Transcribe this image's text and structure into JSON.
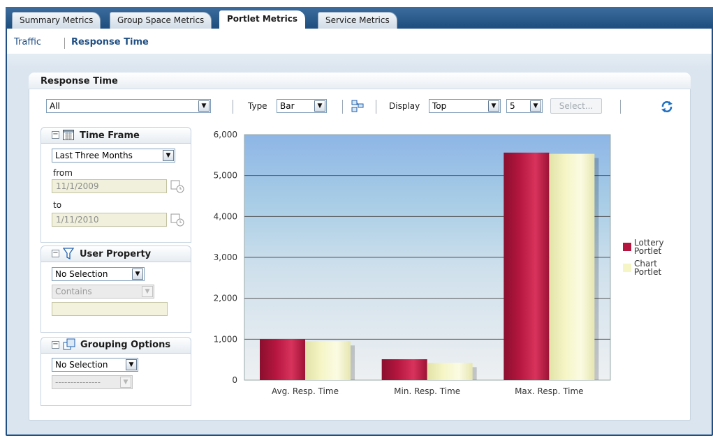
{
  "tabs": [
    {
      "label": "Summary Metrics",
      "active": false
    },
    {
      "label": "Group Space Metrics",
      "active": false
    },
    {
      "label": "Portlet Metrics",
      "active": true
    },
    {
      "label": "Service Metrics",
      "active": false
    }
  ],
  "subnav": {
    "traffic": "Traffic",
    "response_time": "Response Time"
  },
  "section": {
    "title": "Response Time"
  },
  "toolbar": {
    "filter_value": "All",
    "type_label": "Type",
    "type_value": "Bar",
    "display_label": "Display",
    "display_value": "Top",
    "count_value": "5",
    "select_button": "Select..."
  },
  "time_frame": {
    "title": "Time Frame",
    "range_value": "Last Three Months",
    "from_label": "from",
    "from_value": "11/1/2009",
    "to_label": "to",
    "to_value": "1/11/2010"
  },
  "user_property": {
    "title": "User Property",
    "property_value": "No Selection",
    "operator_value": "Contains",
    "text_value": ""
  },
  "grouping": {
    "title": "Grouping Options",
    "group_value": "No Selection",
    "sub_value": "---------------"
  },
  "colors": {
    "lottery": "#b5163f",
    "chart": "#f5f5c6",
    "accent": "#1f4f83"
  },
  "chart_data": {
    "type": "bar",
    "categories": [
      "Avg. Resp. Time",
      "Min. Resp. Time",
      "Max. Resp. Time"
    ],
    "series": [
      {
        "name": "Lottery Portlet",
        "values": [
          1000,
          510,
          5560
        ]
      },
      {
        "name": "Chart Portlet",
        "values": [
          950,
          420,
          5530
        ]
      }
    ],
    "ylim": [
      0,
      6000
    ],
    "yticks": [
      "0",
      "1,000",
      "2,000",
      "3,000",
      "4,000",
      "5,000",
      "6,000"
    ],
    "grid": true,
    "legend": "right"
  }
}
